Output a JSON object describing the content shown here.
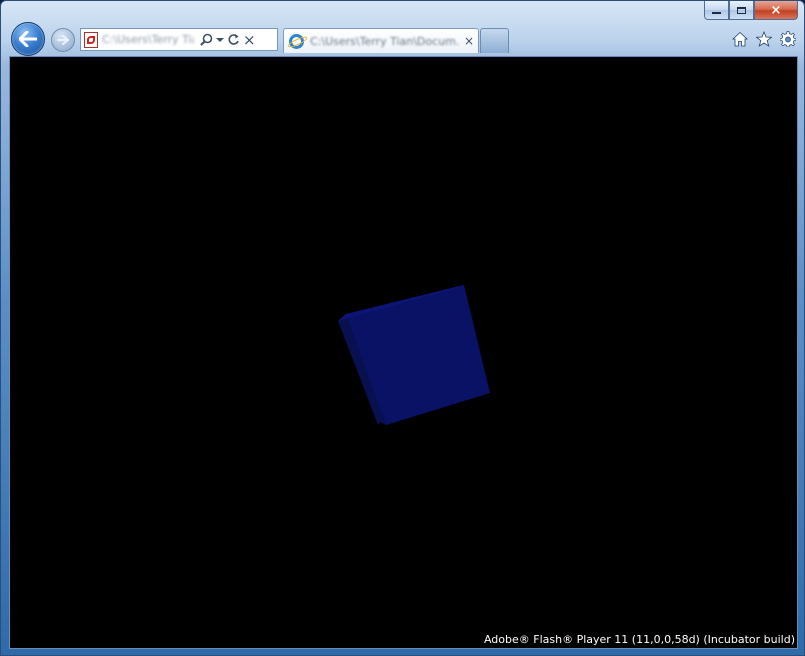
{
  "window": {
    "caption_buttons": {
      "minimize": "minimize-icon",
      "maximize": "maximize-icon",
      "close": "×"
    }
  },
  "toolbar": {
    "back_icon": "back-arrow-icon",
    "forward_icon": "forward-arrow-icon",
    "address": {
      "value": "C:\\Users\\Terry Tian\\",
      "file_icon": "pdf-file-icon",
      "search_icon": "magnifier-icon",
      "dropdown_icon": "chevron-down-icon",
      "refresh_icon": "refresh-icon",
      "stop_icon": "×"
    },
    "tab": {
      "label": "C:\\Users\\Terry Tian\\Docum...",
      "icon": "ie-icon",
      "close": "×"
    },
    "right_icons": [
      "home-icon",
      "star-icon",
      "gear-icon"
    ]
  },
  "content": {
    "background": "#000000",
    "cube_color": "#0a1266",
    "footer_text": "Adobe® Flash® Player 11 (11,0,0,58d) (Incubator build)"
  }
}
